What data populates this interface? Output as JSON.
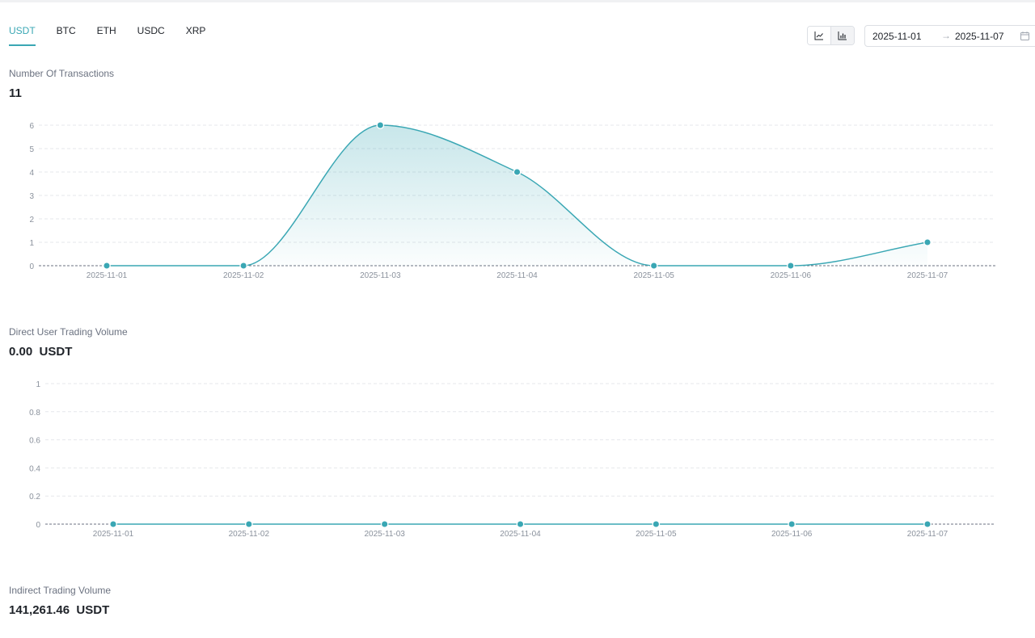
{
  "tabs": [
    {
      "label": "USDT",
      "active": true
    },
    {
      "label": "BTC",
      "active": false
    },
    {
      "label": "ETH",
      "active": false
    },
    {
      "label": "USDC",
      "active": false
    },
    {
      "label": "XRP",
      "active": false
    }
  ],
  "view_toggle": {
    "selected": "line-chart-icon",
    "other": "bar-chart-icon"
  },
  "date_range": {
    "start": "2025-11-01",
    "separator": "→",
    "end": "2025-11-07"
  },
  "colors": {
    "accent": "#3aa7b4",
    "grid": "#e5e7eb",
    "axis_text": "#8a919c"
  },
  "sections": {
    "transactions": {
      "title": "Number Of Transactions",
      "value": "11"
    },
    "direct_volume": {
      "title": "Direct User Trading Volume",
      "value": "0.00  USDT"
    },
    "indirect_volume": {
      "title": "Indirect Trading Volume",
      "value": "141,261.46  USDT"
    }
  },
  "chart_data": [
    {
      "type": "area",
      "x": [
        "2025-11-01",
        "2025-11-02",
        "2025-11-03",
        "2025-11-04",
        "2025-11-05",
        "2025-11-06",
        "2025-11-07"
      ],
      "values": [
        0,
        0,
        6,
        4,
        0,
        0,
        1
      ],
      "ylim": [
        0,
        6
      ],
      "yticks": [
        0,
        1,
        2,
        3,
        4,
        5,
        6
      ],
      "grid": true
    },
    {
      "type": "line",
      "x": [
        "2025-11-01",
        "2025-11-02",
        "2025-11-03",
        "2025-11-04",
        "2025-11-05",
        "2025-11-06",
        "2025-11-07"
      ],
      "values": [
        0,
        0,
        0,
        0,
        0,
        0,
        0
      ],
      "ylim": [
        0,
        1
      ],
      "yticks": [
        0,
        0.2,
        0.4,
        0.6,
        0.8,
        1
      ],
      "grid": true
    }
  ]
}
